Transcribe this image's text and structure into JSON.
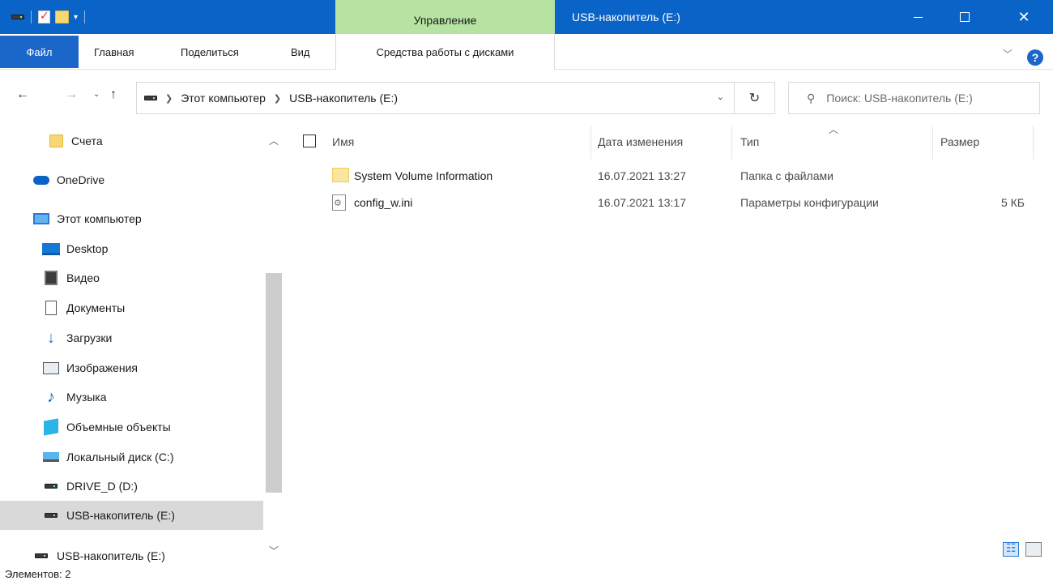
{
  "window": {
    "title": "USB-накопитель (E:)",
    "context_tab_group": "Управление",
    "controls": {
      "minimize": "minimize",
      "maximize": "maximize",
      "close": "✕"
    }
  },
  "ribbon": {
    "tabs": [
      "Файл",
      "Главная",
      "Поделиться",
      "Вид",
      "Средства работы с дисками"
    ],
    "help": "?"
  },
  "address": {
    "crumbs": [
      "Этот компьютер",
      "USB-накопитель (E:)"
    ],
    "search_placeholder": "Поиск: USB-накопитель (E:)"
  },
  "nav_pane": {
    "items": [
      {
        "label": "Счета",
        "icon": "folder-icon"
      },
      {
        "label": "OneDrive",
        "icon": "onedrive-icon"
      },
      {
        "label": "Этот компьютер",
        "icon": "computer-icon"
      },
      {
        "label": "Desktop",
        "icon": "desktop-icon"
      },
      {
        "label": "Видео",
        "icon": "video-icon"
      },
      {
        "label": "Документы",
        "icon": "documents-icon"
      },
      {
        "label": "Загрузки",
        "icon": "downloads-icon"
      },
      {
        "label": "Изображения",
        "icon": "pictures-icon"
      },
      {
        "label": "Музыка",
        "icon": "music-icon"
      },
      {
        "label": "Объемные объекты",
        "icon": "3d-objects-icon"
      },
      {
        "label": "Локальный диск (C:)",
        "icon": "local-disk-icon"
      },
      {
        "label": "DRIVE_D (D:)",
        "icon": "drive-icon"
      },
      {
        "label": "USB-накопитель (E:)",
        "icon": "usb-drive-icon",
        "selected": true
      },
      {
        "label": "USB-накопитель (E:)",
        "icon": "usb-drive-icon"
      }
    ]
  },
  "columns": [
    "Имя",
    "Дата изменения",
    "Тип",
    "Размер"
  ],
  "files": [
    {
      "name": "System Volume Information",
      "date": "16.07.2021 13:27",
      "type": "Папка с файлами",
      "size": ""
    },
    {
      "name": "config_w.ini",
      "date": "16.07.2021 13:17",
      "type": "Параметры конфигурации",
      "size": "5 КБ"
    }
  ],
  "status": {
    "count": "Элементов: 2"
  }
}
